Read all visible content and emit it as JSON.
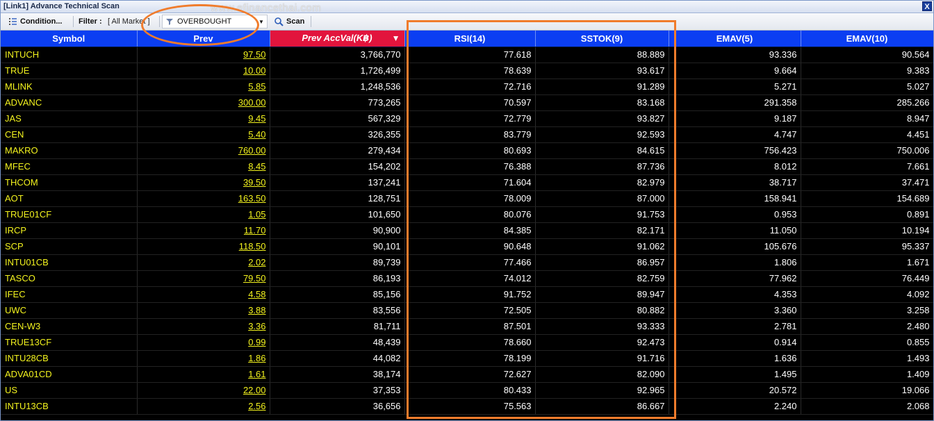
{
  "window": {
    "title": "[Link1] Advance Technical Scan",
    "close_label": "X"
  },
  "watermark": "www.efinancethai.com",
  "toolbar": {
    "condition_label": "Condition...",
    "filter_label": "Filter :",
    "filter_value": "[ All Market ]",
    "scan_select_value": "OVERBOUGHT",
    "scan_label": "Scan"
  },
  "table": {
    "headers": [
      "Symbol",
      "Prev",
      "Prev AccVal(K฿)",
      "RSI(14)",
      "SSTOK(9)",
      "EMAV(5)",
      "EMAV(10)"
    ],
    "sort_indicator": "▼",
    "rows": [
      [
        "INTUCH",
        "97.50",
        "3,766,770",
        "77.618",
        "88.889",
        "93.336",
        "90.564"
      ],
      [
        "TRUE",
        "10.00",
        "1,726,499",
        "78.639",
        "93.617",
        "9.664",
        "9.383"
      ],
      [
        "MLINK",
        "5.85",
        "1,248,536",
        "72.716",
        "91.289",
        "5.271",
        "5.027"
      ],
      [
        "ADVANC",
        "300.00",
        "773,265",
        "70.597",
        "83.168",
        "291.358",
        "285.266"
      ],
      [
        "JAS",
        "9.45",
        "567,329",
        "72.779",
        "93.827",
        "9.187",
        "8.947"
      ],
      [
        "CEN",
        "5.40",
        "326,355",
        "83.779",
        "92.593",
        "4.747",
        "4.451"
      ],
      [
        "MAKRO",
        "760.00",
        "279,434",
        "80.693",
        "84.615",
        "756.423",
        "750.006"
      ],
      [
        "MFEC",
        "8.45",
        "154,202",
        "76.388",
        "87.736",
        "8.012",
        "7.661"
      ],
      [
        "THCOM",
        "39.50",
        "137,241",
        "71.604",
        "82.979",
        "38.717",
        "37.471"
      ],
      [
        "AOT",
        "163.50",
        "128,751",
        "78.009",
        "87.000",
        "158.941",
        "154.689"
      ],
      [
        "TRUE01CF",
        "1.05",
        "101,650",
        "80.076",
        "91.753",
        "0.953",
        "0.891"
      ],
      [
        "IRCP",
        "11.70",
        "90,900",
        "84.385",
        "82.171",
        "11.050",
        "10.194"
      ],
      [
        "SCP",
        "118.50",
        "90,101",
        "90.648",
        "91.062",
        "105.676",
        "95.337"
      ],
      [
        "INTU01CB",
        "2.02",
        "89,739",
        "77.466",
        "86.957",
        "1.806",
        "1.671"
      ],
      [
        "TASCO",
        "79.50",
        "86,193",
        "74.012",
        "82.759",
        "77.962",
        "76.449"
      ],
      [
        "IFEC",
        "4.58",
        "85,156",
        "91.752",
        "89.947",
        "4.353",
        "4.092"
      ],
      [
        "UWC",
        "3.88",
        "83,556",
        "72.505",
        "80.882",
        "3.360",
        "3.258"
      ],
      [
        "CEN-W3",
        "3.36",
        "81,711",
        "87.501",
        "93.333",
        "2.781",
        "2.480"
      ],
      [
        "TRUE13CF",
        "0.99",
        "48,439",
        "78.660",
        "92.473",
        "0.914",
        "0.855"
      ],
      [
        "INTU28CB",
        "1.86",
        "44,082",
        "78.199",
        "91.716",
        "1.636",
        "1.493"
      ],
      [
        "ADVA01CD",
        "1.61",
        "38,174",
        "72.627",
        "82.090",
        "1.495",
        "1.409"
      ],
      [
        "US",
        "22.00",
        "37,353",
        "80.433",
        "92.965",
        "20.572",
        "19.066"
      ],
      [
        "INTU13CB",
        "2.56",
        "36,656",
        "75.563",
        "86.667",
        "2.240",
        "2.068"
      ]
    ]
  },
  "icons": {
    "condition": "condition-grip-icon",
    "scan_select": "filter-funnel-icon",
    "scan": "search-icon",
    "dropdown": "chevron-down-icon"
  },
  "colors": {
    "header_bg": "#0b3ef2",
    "sorted_header_bg": "#e2143d",
    "symbol_text": "#f3f31e",
    "highlight": "#f07c2c"
  }
}
